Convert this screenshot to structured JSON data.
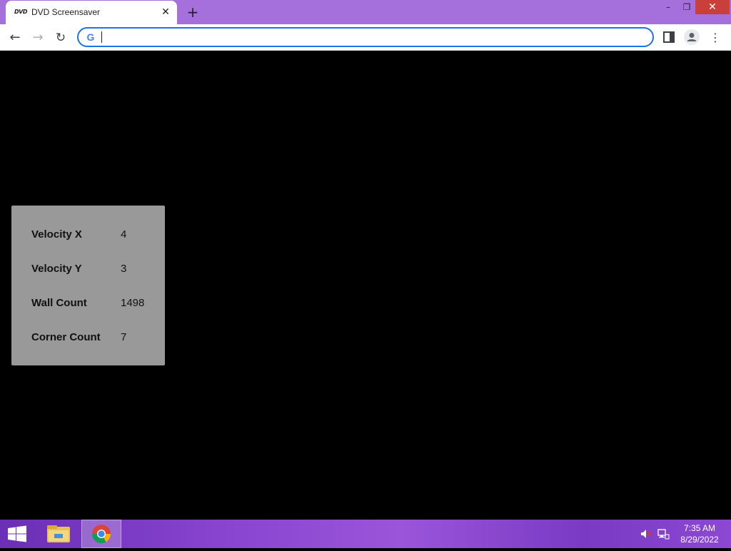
{
  "browser": {
    "tab": {
      "favicon_text": "DVD",
      "title": "DVD Screensaver",
      "close_glyph": "✕"
    },
    "new_tab_glyph": "+",
    "window_controls": {
      "minimize_glyph": "–",
      "maximize_glyph": "❐",
      "close_glyph": "✕"
    },
    "toolbar": {
      "back_glyph": "←",
      "forward_glyph": "→",
      "reload_glyph": "↻",
      "menu_glyph": "⋮",
      "omnibox": {
        "value": "",
        "search_engine_icon": "G"
      }
    },
    "colors": {
      "titlebar": "#a56fdc",
      "omnibox_focus": "#1a73e8"
    }
  },
  "page": {
    "background": "#000000",
    "stats": [
      {
        "label": "Velocity X",
        "value": "4"
      },
      {
        "label": "Velocity Y",
        "value": "3"
      },
      {
        "label": "Wall Count",
        "value": "1498"
      },
      {
        "label": "Corner Count",
        "value": "7"
      }
    ],
    "panel_color": "#999999"
  },
  "taskbar": {
    "apps": [
      "start-icon",
      "file-explorer-icon",
      "chrome-icon"
    ],
    "tray": [
      "speaker-muted-icon",
      "network-icon"
    ],
    "clock": {
      "time": "7:35 AM",
      "date": "8/29/2022"
    }
  }
}
